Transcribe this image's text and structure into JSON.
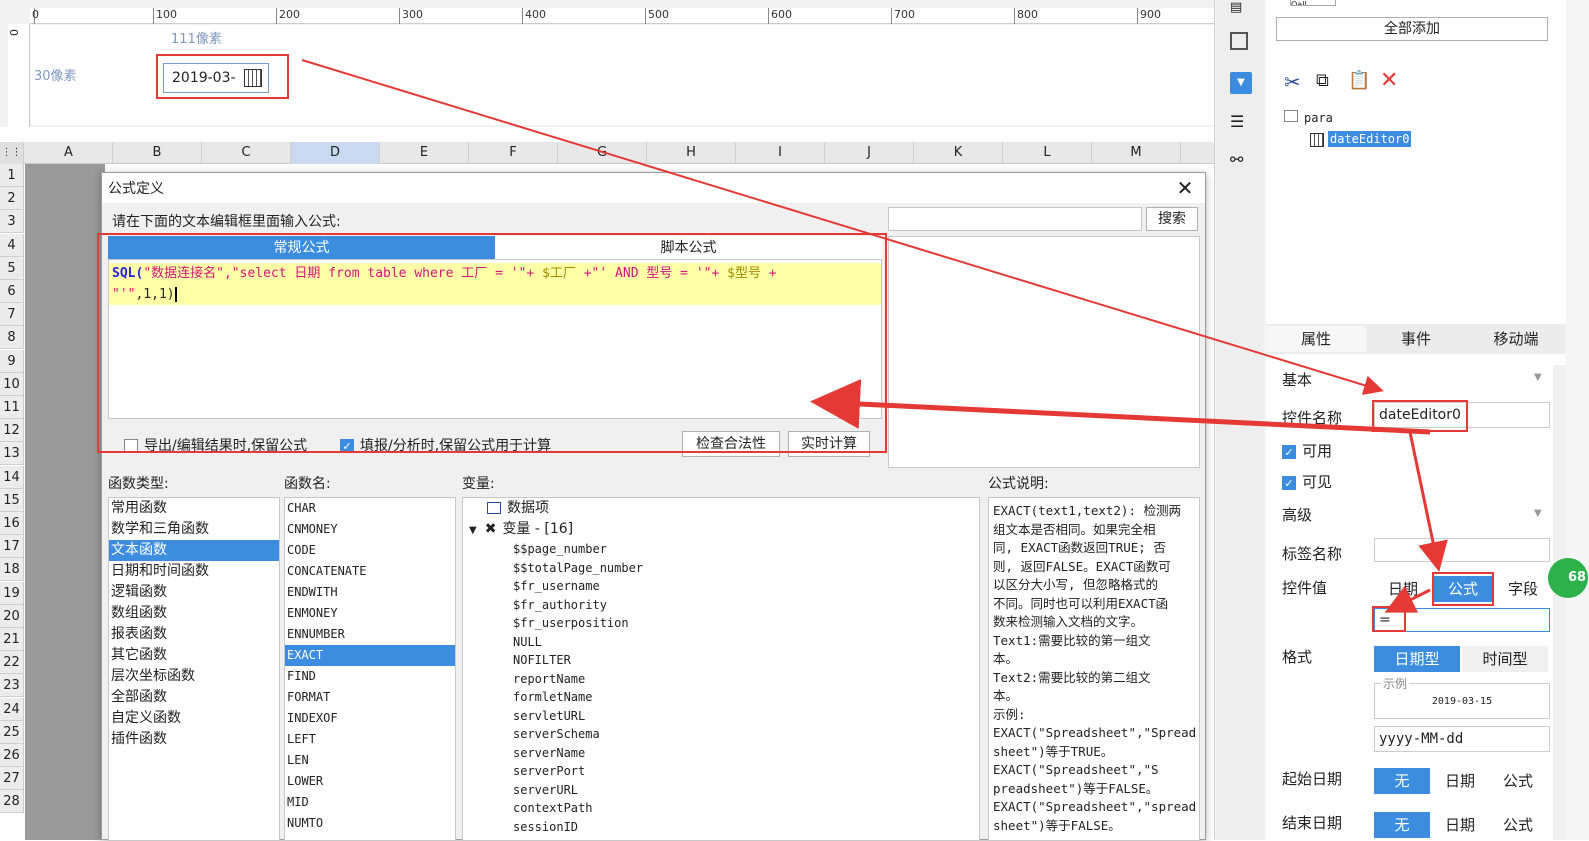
{
  "ruler": {
    "ticks": [
      "0",
      "100",
      "200",
      "300",
      "400",
      "500",
      "600",
      "700",
      "800",
      "900"
    ],
    "v_tick": "0",
    "width_label": "111像素",
    "height_label": "30像素"
  },
  "date_widget": {
    "value": "2019-03-"
  },
  "sheet": {
    "columns": [
      "A",
      "B",
      "C",
      "D",
      "E",
      "F",
      "G",
      "H",
      "I",
      "J",
      "K",
      "L",
      "M"
    ],
    "rows": [
      "1",
      "2",
      "3",
      "4",
      "5",
      "6",
      "7",
      "8",
      "9",
      "10",
      "11",
      "12",
      "13",
      "14",
      "15",
      "16",
      "17",
      "18",
      "19",
      "20",
      "21",
      "22",
      "23",
      "24",
      "25",
      "26",
      "27",
      "28"
    ]
  },
  "dialog": {
    "title": "公式定义",
    "prompt": "请在下面的文本编辑框里面输入公式:",
    "search_button": "搜索",
    "tabs": [
      "常规公式",
      "脚本公式"
    ],
    "formula_line1": {
      "fn": "SQL(",
      "a": "\"数据连接名\",\"select 日期 from table where 工厂 = '\"+ ",
      "b": "$工厂",
      "c": " +\"' AND 型号 = '\"+ ",
      "d": "$型号",
      "e": " +"
    },
    "formula_line2": {
      "a": "\"'\"",
      "b": ",1,1)"
    },
    "checkbox1": "导出/编辑结果时,保留公式",
    "checkbox2": "填报/分析时,保留公式用于计算",
    "check_button": "检查合法性",
    "realtime_button": "实时计算",
    "fn_type_label": "函数类型:",
    "fn_name_label": "函数名:",
    "var_label": "变量:",
    "desc_label": "公式说明:",
    "fn_types": [
      "常用函数",
      "数学和三角函数",
      "文本函数",
      "日期和时间函数",
      "逻辑函数",
      "数组函数",
      "报表函数",
      "其它函数",
      "层次坐标函数",
      "全部函数",
      "自定义函数",
      "插件函数"
    ],
    "fn_type_selected": "文本函数",
    "fn_names": [
      "CHAR",
      "CNMONEY",
      "CODE",
      "CONCATENATE",
      "ENDWITH",
      "ENMONEY",
      "ENNUMBER",
      "EXACT",
      "FIND",
      "FORMAT",
      "INDEXOF",
      "LEFT",
      "LEN",
      "LOWER",
      "MID",
      "NUMTO"
    ],
    "fn_name_selected": "EXACT",
    "var_data_item": "数据项",
    "var_group": "变量 - [16]",
    "vars": [
      "$$page_number",
      "$$totalPage_number",
      "$fr_username",
      "$fr_authority",
      "$fr_userposition",
      "NULL",
      "NOFILTER",
      "reportName",
      "formletName",
      "servletURL",
      "serverSchema",
      "serverName",
      "serverPort",
      "serverURL",
      "contextPath",
      "sessionID"
    ],
    "desc_lines": [
      "EXACT(text1,text2): 检测两",
      "组文本是否相同。如果完全相",
      "同, EXACT函数返回TRUE; 否",
      "则, 返回FALSE。EXACT函数可",
      "以区分大小写, 但忽略格式的",
      "不同。同时也可以利用EXACT函",
      "数来检测输入文档的文字。",
      "Text1:需要比较的第一组文",
      "本。",
      "Text2:需要比较的第二组文",
      "本。",
      "示例:",
      "EXACT(\"Spreadsheet\",\"Spread",
      "sheet\")等于TRUE。",
      "EXACT(\"Spreadsheet\",\"S",
      "preadsheet\")等于FALSE。",
      "EXACT(\"Spreadsheet\",\"spread",
      "sheet\")等于FALSE。"
    ]
  },
  "right_panel": {
    "top_partial": "Qall",
    "add_all_button": "全部添加",
    "tree_root": "para",
    "tree_child": "dateEditor0",
    "tabs": [
      "属性",
      "事件",
      "移动端"
    ],
    "section_basic": "基本",
    "ctrl_name_label": "控件名称",
    "ctrl_name_value": "dateEditor0",
    "enabled_label": "可用",
    "visible_label": "可见",
    "section_adv": "高级",
    "tag_name_label": "标签名称",
    "ctrl_value_label": "控件值",
    "value_modes": [
      "日期",
      "公式",
      "字段"
    ],
    "value_mode_selected": "公式",
    "formula_value": "=",
    "format_label": "格式",
    "format_modes": [
      "日期型",
      "时间型"
    ],
    "example_label": "示例",
    "example_value": "2019-03-15",
    "format_value": "yyyy-MM-dd",
    "start_date_label": "起始日期",
    "end_date_label": "结束日期",
    "date_modes": [
      "无",
      "日期",
      "公式"
    ],
    "badge": "68"
  },
  "colors": {
    "accent": "#3c8de0",
    "annotation": "#e53935",
    "editor_line": "#ffffa8"
  }
}
